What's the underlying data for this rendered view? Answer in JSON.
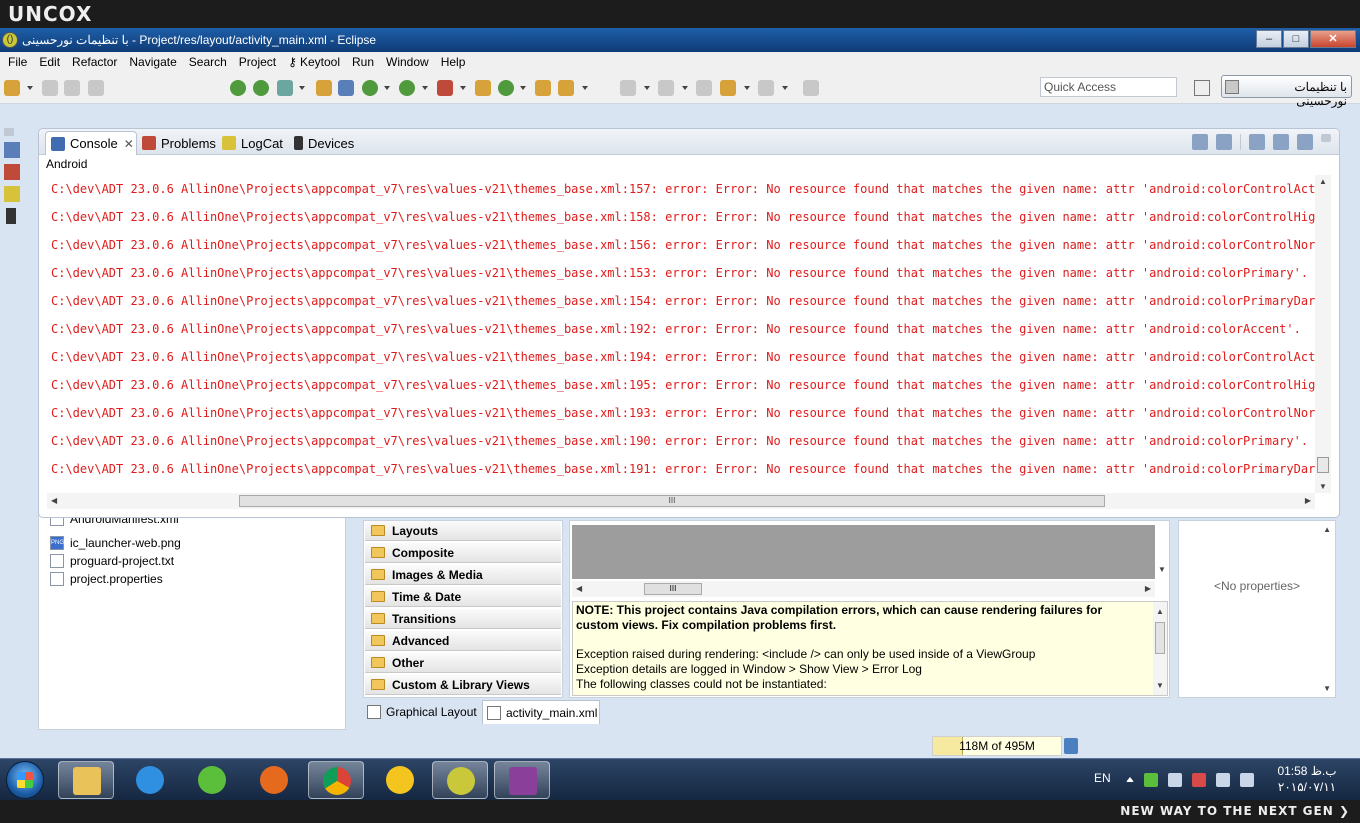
{
  "brand": {
    "top_logo": "UNCOX",
    "bottom_tagline": "NEW WAY TO THE NEXT GEN ❯"
  },
  "window": {
    "title": "با تنظیمات نورحسینی - Project/res/layout/activity_main.xml - Eclipse",
    "buttons": {
      "minimize": "–",
      "maximize": "□",
      "close": "✕"
    }
  },
  "menu": [
    "File",
    "Edit",
    "Refactor",
    "Navigate",
    "Search",
    "Project",
    "Keytool",
    "Run",
    "Window",
    "Help"
  ],
  "toolbar": {
    "quick_access_placeholder": "Quick Access",
    "perspective_label": "با تنظیمات نورحسینی"
  },
  "console": {
    "tabs": [
      "Console",
      "Problems",
      "LogCat",
      "Devices"
    ],
    "tab_close": "✕",
    "label": "Android",
    "lines": [
      "C:\\dev\\ADT 23.0.6 AllinOne\\Projects\\appcompat_v7\\res\\values-v21\\themes_base.xml:157: error: Error: No resource found that matches the given name: attr 'android:colorControlActivated'.",
      "C:\\dev\\ADT 23.0.6 AllinOne\\Projects\\appcompat_v7\\res\\values-v21\\themes_base.xml:158: error: Error: No resource found that matches the given name: attr 'android:colorControlHighlight'.",
      "C:\\dev\\ADT 23.0.6 AllinOne\\Projects\\appcompat_v7\\res\\values-v21\\themes_base.xml:156: error: Error: No resource found that matches the given name: attr 'android:colorControlNormal'.",
      "C:\\dev\\ADT 23.0.6 AllinOne\\Projects\\appcompat_v7\\res\\values-v21\\themes_base.xml:153: error: Error: No resource found that matches the given name: attr 'android:colorPrimary'.",
      "C:\\dev\\ADT 23.0.6 AllinOne\\Projects\\appcompat_v7\\res\\values-v21\\themes_base.xml:154: error: Error: No resource found that matches the given name: attr 'android:colorPrimaryDark'.",
      "C:\\dev\\ADT 23.0.6 AllinOne\\Projects\\appcompat_v7\\res\\values-v21\\themes_base.xml:192: error: Error: No resource found that matches the given name: attr 'android:colorAccent'.",
      "C:\\dev\\ADT 23.0.6 AllinOne\\Projects\\appcompat_v7\\res\\values-v21\\themes_base.xml:194: error: Error: No resource found that matches the given name: attr 'android:colorControlActivated'.",
      "C:\\dev\\ADT 23.0.6 AllinOne\\Projects\\appcompat_v7\\res\\values-v21\\themes_base.xml:195: error: Error: No resource found that matches the given name: attr 'android:colorControlHighlight'.",
      "C:\\dev\\ADT 23.0.6 AllinOne\\Projects\\appcompat_v7\\res\\values-v21\\themes_base.xml:193: error: Error: No resource found that matches the given name: attr 'android:colorControlNormal'.",
      "C:\\dev\\ADT 23.0.6 AllinOne\\Projects\\appcompat_v7\\res\\values-v21\\themes_base.xml:190: error: Error: No resource found that matches the given name: attr 'android:colorPrimary'.",
      "C:\\dev\\ADT 23.0.6 AllinOne\\Projects\\appcompat_v7\\res\\values-v21\\themes_base.xml:191: error: Error: No resource found that matches the given name: attr 'android:colorPrimaryDark'."
    ],
    "error_color": "#e01b1b",
    "scroll_thumb_glyph": "III"
  },
  "explorer": {
    "files": [
      {
        "name": "AndroidManifest.xml",
        "icon": "xml-file-icon"
      },
      {
        "name": "ic_launcher-web.png",
        "icon": "png-file-icon",
        "badge": "PNG"
      },
      {
        "name": "proguard-project.txt",
        "icon": "text-file-icon"
      },
      {
        "name": "project.properties",
        "icon": "text-file-icon"
      }
    ]
  },
  "palette": {
    "categories": [
      "Layouts",
      "Composite",
      "Images & Media",
      "Time & Date",
      "Transitions",
      "Advanced",
      "Other",
      "Custom & Library Views"
    ]
  },
  "editor": {
    "note_bold": "NOTE: This project contains Java compilation errors, which can cause rendering failures for custom views. Fix compilation problems first.",
    "note_lines": [
      "Exception raised during rendering: <include /> can only be used inside of a ViewGroup",
      "Exception details are logged in Window > Show View > Error Log",
      "The following classes could not be instantiated:"
    ],
    "tabs": [
      "Graphical Layout",
      "activity_main.xml"
    ]
  },
  "properties": {
    "empty_label": "<No properties>"
  },
  "status": {
    "heap": "118M of 495M",
    "heap_used_fraction": 0.238
  },
  "taskbar": {
    "apps": [
      "windows-explorer-icon",
      "internet-explorer-icon",
      "bitcomet-icon",
      "firefox-icon",
      "chrome-icon",
      "yahoo-messenger-icon",
      "eclipse-adt-icon",
      "winrar-icon"
    ],
    "language": "EN",
    "time": "ب.ظ 01:58",
    "date": "۲۰۱۵/۰۷/۱۱"
  }
}
